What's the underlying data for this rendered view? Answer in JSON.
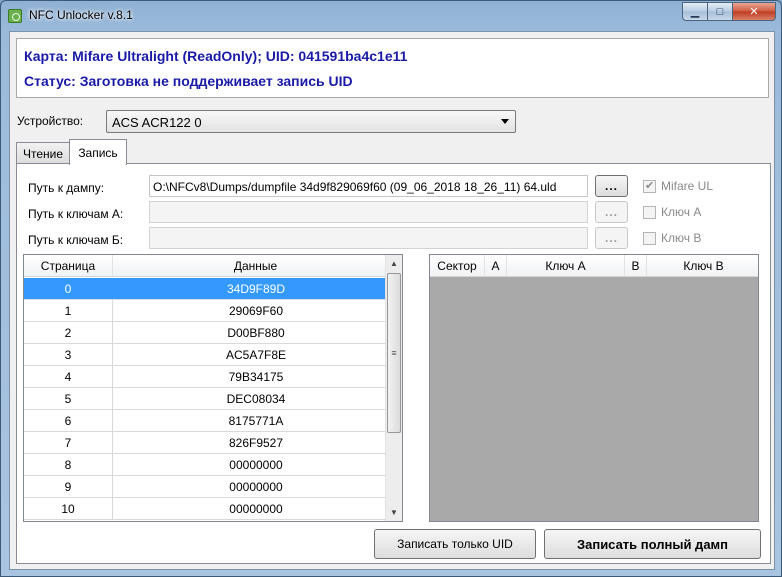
{
  "window": {
    "title": "NFC Unlocker v.8.1"
  },
  "info": {
    "card_line": "Карта: Mifare Ultralight (ReadOnly); UID: 041591ba4c1e11",
    "status_line": "Статус: Заготовка не поддерживает запись UID"
  },
  "device": {
    "label": "Устройство:",
    "value": "ACS ACR122 0"
  },
  "tabs": [
    {
      "label": "Чтение",
      "active": false
    },
    {
      "label": "Запись",
      "active": true
    }
  ],
  "paths": {
    "dump_label": "Путь к дампу:",
    "dump_value": "O:\\NFCv8\\Dumps/dumpfile 34d9f829069f60 (09_06_2018 18_26_11) 64.uld",
    "keys_a_label": "Путь к ключам А:",
    "keys_a_value": "",
    "keys_b_label": "Путь к ключам Б:",
    "keys_b_value": "",
    "browse_label": "..."
  },
  "options": {
    "mifare_ul": {
      "label": "Mifare UL",
      "checked": true
    },
    "key_a": {
      "label": "Ключ А",
      "checked": false
    },
    "key_b": {
      "label": "Ключ B",
      "checked": false
    }
  },
  "pages_table": {
    "headers": [
      "Страница",
      "Данные"
    ],
    "selected_row": 0,
    "rows": [
      [
        "0",
        "34D9F89D"
      ],
      [
        "1",
        "29069F60"
      ],
      [
        "2",
        "D00BF880"
      ],
      [
        "3",
        "AC5A7F8E"
      ],
      [
        "4",
        "79B34175"
      ],
      [
        "5",
        "DEC08034"
      ],
      [
        "6",
        "8175771A"
      ],
      [
        "7",
        "826F9527"
      ],
      [
        "8",
        "00000000"
      ],
      [
        "9",
        "00000000"
      ],
      [
        "10",
        "00000000"
      ]
    ]
  },
  "sectors_table": {
    "headers": [
      "Сектор",
      "A",
      "Ключ A",
      "B",
      "Ключ B"
    ]
  },
  "actions": {
    "write_uid": "Записать только UID",
    "write_full": "Записать полный дамп"
  },
  "icons": {
    "minimize": "minimize-icon",
    "maximize": "maximize-icon",
    "close": "close-icon",
    "app": "nfc-app-icon"
  }
}
